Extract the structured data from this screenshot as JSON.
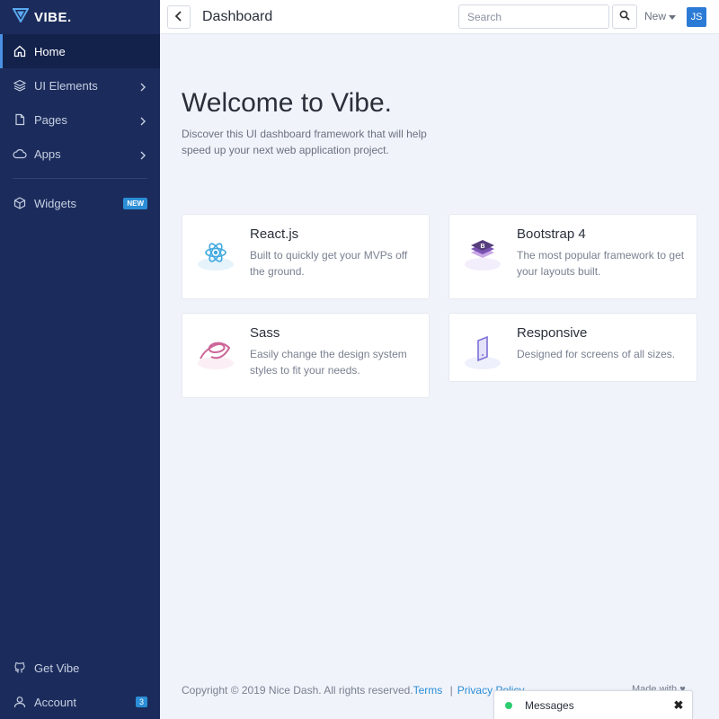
{
  "brand": {
    "name": "VIBE."
  },
  "sidebar": {
    "items": [
      {
        "label": "Home",
        "icon": "home-icon"
      },
      {
        "label": "UI Elements",
        "icon": "layers-icon"
      },
      {
        "label": "Pages",
        "icon": "file-icon"
      },
      {
        "label": "Apps",
        "icon": "cloud-icon"
      },
      {
        "label": "Widgets",
        "icon": "package-icon",
        "badge": "NEW"
      }
    ],
    "bottom": [
      {
        "label": "Get Vibe",
        "icon": "github-icon"
      },
      {
        "label": "Account",
        "icon": "user-icon",
        "badge": "3"
      }
    ]
  },
  "header": {
    "title": "Dashboard",
    "search_placeholder": "Search",
    "new_label": "New",
    "avatar_initials": "JS"
  },
  "hero": {
    "title": "Welcome to Vibe.",
    "subtitle": "Discover this UI dashboard framework that will help speed up your next web application project."
  },
  "cards": [
    {
      "title": "React.js",
      "desc": "Built to quickly get your MVPs off the ground."
    },
    {
      "title": "Bootstrap 4",
      "desc": "The most popular framework to get your layouts built."
    },
    {
      "title": "Sass",
      "desc": "Easily change the design system styles to fit your needs."
    },
    {
      "title": "Responsive",
      "desc": "Designed for screens of all sizes."
    }
  ],
  "footer": {
    "copyright": "Copyright © 2019 Nice Dash. All rights reserved.",
    "terms": "Terms",
    "separator": "|",
    "privacy": "Privacy Policy",
    "made_with": "Made with ♥"
  },
  "messages": {
    "label": "Messages",
    "close": "✖"
  },
  "colors": {
    "sidebar": "#1b2c5c",
    "accent": "#2b8ed6",
    "online": "#2ecc71"
  }
}
